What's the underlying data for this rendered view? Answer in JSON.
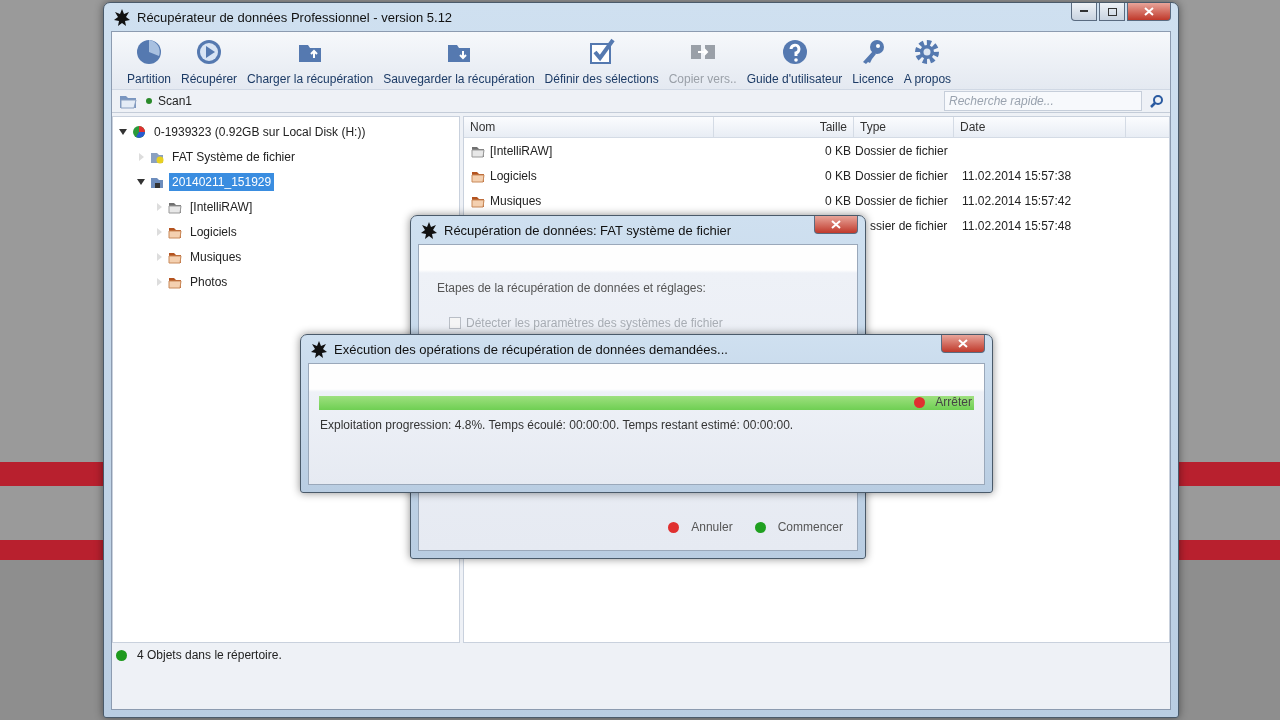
{
  "window": {
    "title": "Récupérateur de données Professionnel - version 5.12"
  },
  "toolbar": [
    {
      "label": "Partition",
      "kind": "pie",
      "disabled": false
    },
    {
      "label": "Récupérer",
      "kind": "play",
      "disabled": false
    },
    {
      "label": "Charger la récupération",
      "kind": "folder-up",
      "disabled": false
    },
    {
      "label": "Sauvegarder la récupération",
      "kind": "folder-down",
      "disabled": false
    },
    {
      "label": "Définir des sélections",
      "kind": "check",
      "disabled": false
    },
    {
      "label": "Copier vers..",
      "kind": "copy",
      "disabled": true
    },
    {
      "label": "Guide d'utilisateur",
      "kind": "help",
      "disabled": false
    },
    {
      "label": "Licence",
      "kind": "key",
      "disabled": false
    },
    {
      "label": "A propos",
      "kind": "gear",
      "disabled": false
    }
  ],
  "address": {
    "crumb": "Scan1",
    "search": {
      "placeholder": "Recherche rapide..."
    }
  },
  "tree": [
    {
      "label": "0-1939323 (0.92GB sur Local Disk (H:))",
      "kind": "disk",
      "expanded": true,
      "selected": false,
      "children": [
        {
          "label": "FAT Système de fichier",
          "kind": "filesystem",
          "expanded": false,
          "selected": false
        },
        {
          "label": "20140211_151929",
          "kind": "scan",
          "expanded": true,
          "selected": true,
          "children": [
            {
              "label": "[IntelliRAW]",
              "kind": "raw",
              "expanded": false,
              "selected": false
            },
            {
              "label": "Logiciels",
              "kind": "folder",
              "expanded": false,
              "selected": false
            },
            {
              "label": "Musiques",
              "kind": "folder",
              "expanded": false,
              "selected": false
            },
            {
              "label": "Photos",
              "kind": "folder",
              "expanded": false,
              "selected": false
            }
          ]
        }
      ]
    }
  ],
  "table": {
    "columns": [
      "Nom",
      "Taille",
      "Type",
      "Date"
    ],
    "rows": [
      {
        "kind": "raw",
        "name": "[IntelliRAW]",
        "size": "0 KB",
        "type": "Dossier de fichier"
      },
      {
        "kind": "folder",
        "name": "Logiciels",
        "size": "0 KB",
        "type": "Dossier de fichier",
        "date": "11.02.2014 15:57:38"
      },
      {
        "kind": "folder",
        "name": "Musiques",
        "size": "0 KB",
        "type": "Dossier de fichier",
        "date": "11.02.2014 15:57:42"
      },
      {
        "kind": "hidden",
        "type": "ssier de fichier",
        "date": "11.02.2014 15:57:48"
      }
    ]
  },
  "status_bar": {
    "text": "4 Objets dans le répertoire.",
    "color": "#1e9a1e"
  },
  "settings_dialog": {
    "title": "Récupération de données: FAT système de fichier",
    "heading": "Etapes de la récupération de données et réglages:",
    "options": [
      {
        "label": "Détecter les paramètres des systèmes de fichier",
        "checked": false,
        "disabled": true
      }
    ],
    "buttons": [
      {
        "label": "Annuler",
        "color": "#e03030"
      },
      {
        "label": "Commencer",
        "color": "#20a020"
      }
    ]
  },
  "progress_dialog": {
    "title": "Exécution des opérations de récupération de données demandées...",
    "progress": {
      "level": 1
    },
    "stop": {
      "label": "Arrêter",
      "color": "#e03030"
    },
    "message": "Exploitation progression: 4.8%. Temps écoulé: 00:00:00. Temps restant estimé: 00:00:00."
  }
}
